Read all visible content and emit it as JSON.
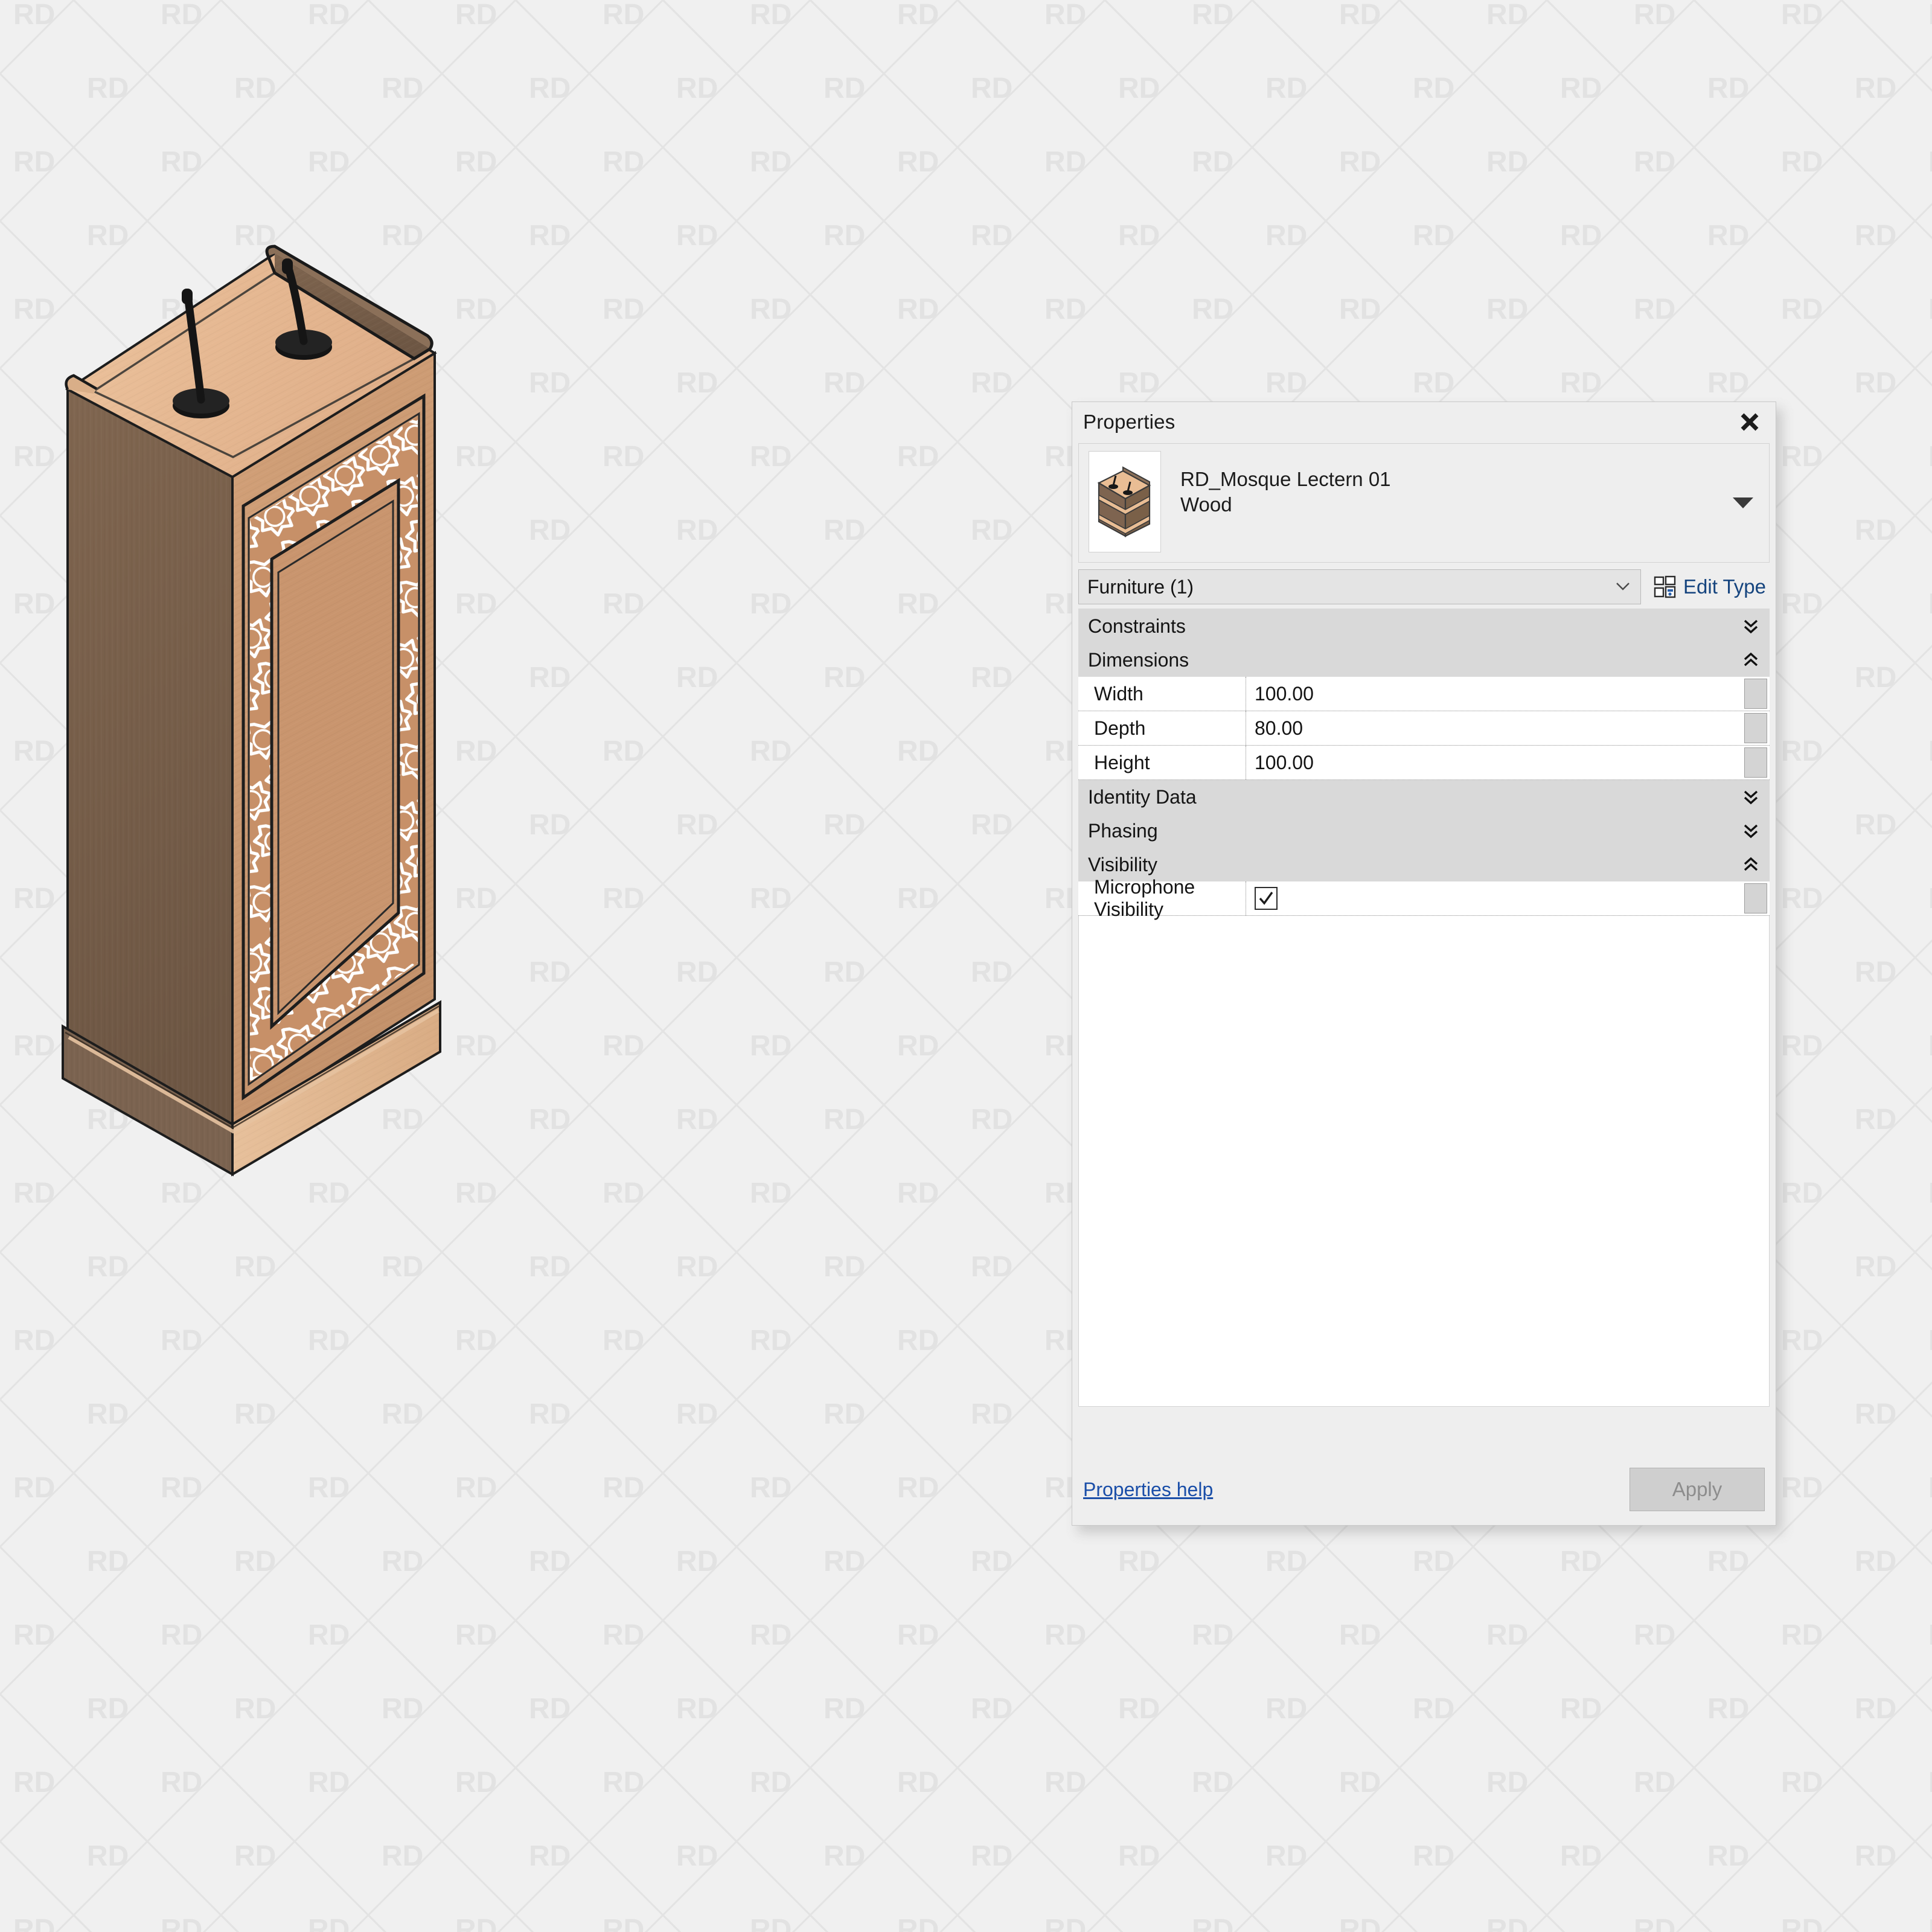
{
  "app": {
    "background_color": "#f0f0f0",
    "watermark_text": "RD"
  },
  "model": {
    "name": "RD_Mosque Lectern 01",
    "description": "Isometric 3D view of a wooden mosque lectern with two gooseneck microphones on the top surface and an Islamic geometric star-pattern decorative border on the front panel.",
    "colors": {
      "wood_light": "#e8bd96",
      "wood_mid": "#cf9f75",
      "wood_dark": "#7e6450",
      "wood_shadow": "#6f5a48",
      "outline": "#1a1a1a",
      "pattern": "#ffffff",
      "mic": "#1c1c1c"
    }
  },
  "panel": {
    "title": "Properties",
    "close_label": "Close",
    "type_name_line1": "RD_Mosque Lectern 01",
    "type_name_line2": "Wood",
    "category_selector": "Furniture (1)",
    "edit_type_label": "Edit Type",
    "groups": [
      {
        "label": "Constraints",
        "state": "collapsed",
        "rows": []
      },
      {
        "label": "Dimensions",
        "state": "expanded",
        "rows": [
          {
            "name": "Width",
            "value": "100.00"
          },
          {
            "name": "Depth",
            "value": "80.00"
          },
          {
            "name": "Height",
            "value": "100.00"
          }
        ]
      },
      {
        "label": "Identity Data",
        "state": "collapsed",
        "rows": []
      },
      {
        "label": "Phasing",
        "state": "collapsed",
        "rows": []
      },
      {
        "label": "Visibility",
        "state": "expanded",
        "rows": [
          {
            "name": "Microphone Visibility",
            "value": "",
            "type": "checkbox",
            "checked": true
          }
        ]
      }
    ],
    "help_link": "Properties help",
    "apply_button": "Apply",
    "accent_link_color": "#1a4ea8",
    "group_header_color": "#d9d9d9"
  }
}
